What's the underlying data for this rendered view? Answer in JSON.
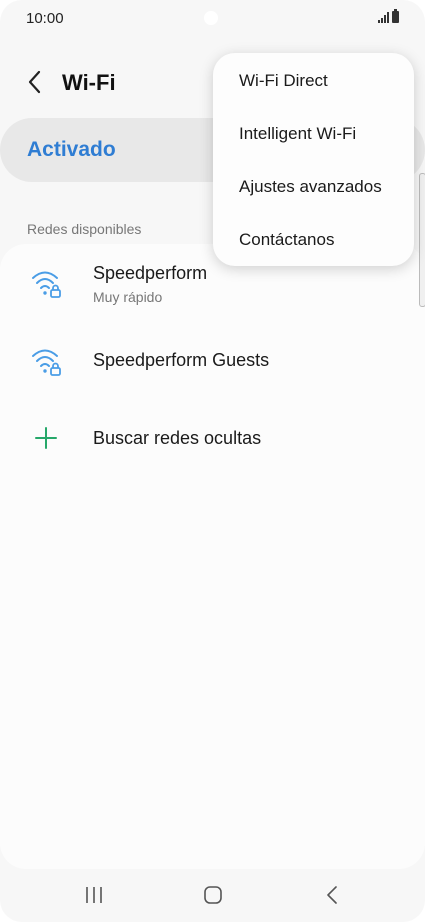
{
  "status_bar": {
    "time": "10:00"
  },
  "header": {
    "title": "Wi-Fi",
    "back_icon": "chevron-left-icon"
  },
  "wifi_toggle": {
    "label": "Activado",
    "state": "on",
    "accent": "#2f7dd3"
  },
  "networks": {
    "section_label": "Redes disponibles",
    "items": [
      {
        "name": "Speedperform",
        "subtitle": "Muy rápido",
        "icon": "wifi-locked-icon"
      },
      {
        "name": "Speedperform Guests",
        "subtitle": "",
        "icon": "wifi-locked-icon"
      }
    ],
    "add_hidden": {
      "label": "Buscar redes ocultas",
      "icon": "plus-icon"
    }
  },
  "overflow_menu": {
    "items": [
      "Wi-Fi Direct",
      "Intelligent Wi-Fi",
      "Ajustes avanzados",
      "Contáctanos"
    ]
  },
  "colors": {
    "wifi_icon": "#4a9de6",
    "plus_icon": "#26a86a",
    "background": "#f7f7f7"
  }
}
